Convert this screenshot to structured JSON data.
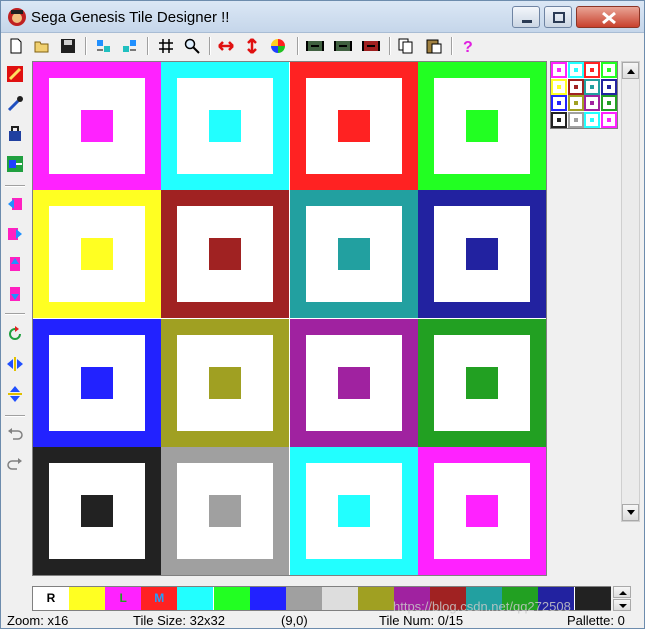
{
  "window": {
    "title": "Sega Genesis Tile Designer !!"
  },
  "toolbar": {
    "items": [
      "new-file-icon",
      "open-folder-icon",
      "save-disk-icon",
      "import-tiles-icon",
      "export-tiles-icon",
      "grid-icon",
      "zoom-icon",
      "flip-horizontal-icon",
      "flip-vertical-icon",
      "color-wheel-icon",
      "tile-copy-left-icon",
      "tile-copy-mid-icon",
      "tile-copy-right-icon",
      "copy-icon",
      "paste-icon",
      "help-icon"
    ]
  },
  "left_tools": [
    "pencil-icon",
    "eyedropper-icon",
    "fill-bucket-icon",
    "replace-color-icon",
    "shift-left-icon",
    "shift-right-icon",
    "shift-up-icon",
    "shift-down-icon",
    "rotate-icon",
    "mirror-horizontal-icon",
    "mirror-vertical-icon",
    "undo-icon",
    "redo-icon"
  ],
  "tiles": {
    "colors": [
      "#ff22ff",
      "#22ffff",
      "#ff2222",
      "#22ff22",
      "#ffff22",
      "#a02222",
      "#22a0a0",
      "#2222a0",
      "#2222ff",
      "#a0a022",
      "#a022a0",
      "#22a022",
      "#222222",
      "#a0a0a0",
      "#22ffff",
      "#ff22ff"
    ]
  },
  "picker": {
    "colors": [
      "#ff22ff",
      "#22ffff",
      "#ff2222",
      "#22ff22",
      "#ffff22",
      "#a02222",
      "#22a0a0",
      "#2222a0",
      "#2222ff",
      "#a0a022",
      "#a022a0",
      "#22a022",
      "#222222",
      "#a0a0a0",
      "#22ffff",
      "#ff22ff"
    ]
  },
  "palette": {
    "swatches": [
      {
        "color": "#ffffff",
        "label": "R",
        "text_color": "#000000"
      },
      {
        "color": "#ffff22",
        "label": "",
        "text_color": "#000000"
      },
      {
        "color": "#ff22ff",
        "label": "L",
        "text_color": "#22a022"
      },
      {
        "color": "#ff2222",
        "label": "M",
        "text_color": "#22a0ff"
      },
      {
        "color": "#22ffff",
        "label": "",
        "text_color": "#000000"
      },
      {
        "color": "#22ff22",
        "label": "",
        "text_color": "#000000"
      },
      {
        "color": "#2222ff",
        "label": "",
        "text_color": "#000000"
      },
      {
        "color": "#a0a0a0",
        "label": "",
        "text_color": "#000000"
      },
      {
        "color": "#dddddd",
        "label": "",
        "text_color": "#000000"
      },
      {
        "color": "#a0a022",
        "label": "",
        "text_color": "#000000"
      },
      {
        "color": "#a022a0",
        "label": "",
        "text_color": "#000000"
      },
      {
        "color": "#a02222",
        "label": "",
        "text_color": "#000000"
      },
      {
        "color": "#22a0a0",
        "label": "",
        "text_color": "#000000"
      },
      {
        "color": "#22a022",
        "label": "",
        "text_color": "#000000"
      },
      {
        "color": "#2222a0",
        "label": "",
        "text_color": "#000000"
      },
      {
        "color": "#222222",
        "label": "",
        "text_color": "#000000"
      }
    ]
  },
  "status": {
    "zoom": "Zoom: x16",
    "tile_size": "Tile Size: 32x32",
    "coords": "(9,0)",
    "tile_num": "Tile Num: 0/15",
    "pallette": "Pallette: 0"
  },
  "watermark": "https://blog.csdn.net/qq272508"
}
